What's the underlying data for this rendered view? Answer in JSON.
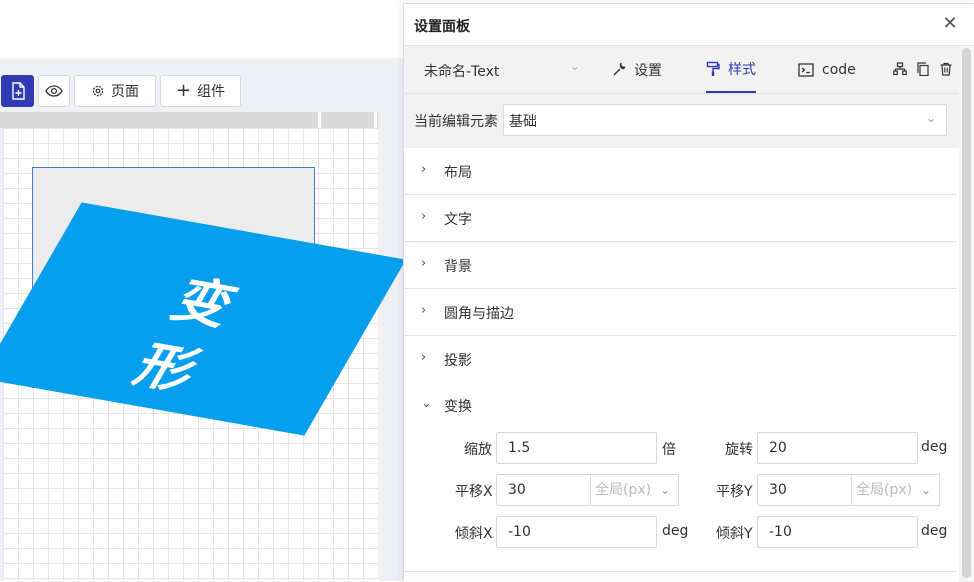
{
  "panel": {
    "title": "设置面板",
    "element_name": "未命名-Text",
    "tabs": [
      {
        "label": "设置",
        "icon": "wrench-icon"
      },
      {
        "label": "样式",
        "icon": "paint-roller-icon"
      },
      {
        "label": "code",
        "icon": "terminal-icon"
      }
    ],
    "current_edit": {
      "label": "当前编辑元素",
      "value": "基础"
    },
    "sections": [
      "布局",
      "文字",
      "背景",
      "圆角与描边",
      "投影",
      "变换"
    ],
    "transform": {
      "scale": {
        "label": "缩放",
        "value": "1.5",
        "unit": "倍"
      },
      "rotate": {
        "label": "旋转",
        "value": "20",
        "unit": "deg"
      },
      "translate_x": {
        "label": "平移X",
        "value": "30",
        "unit": "全局(px)"
      },
      "translate_y": {
        "label": "平移Y",
        "value": "30",
        "unit": "全局(px)"
      },
      "skew_x": {
        "label": "倾斜X",
        "value": "-10",
        "unit": "deg"
      },
      "skew_y": {
        "label": "倾斜Y",
        "value": "-10",
        "unit": "deg"
      }
    }
  },
  "toolbar": {
    "page_label": "页面",
    "components_label": "组件"
  },
  "canvas": {
    "element_text": "变\n形"
  },
  "colors": {
    "accent": "#2f3bb5",
    "element_bg": "#069fee"
  }
}
